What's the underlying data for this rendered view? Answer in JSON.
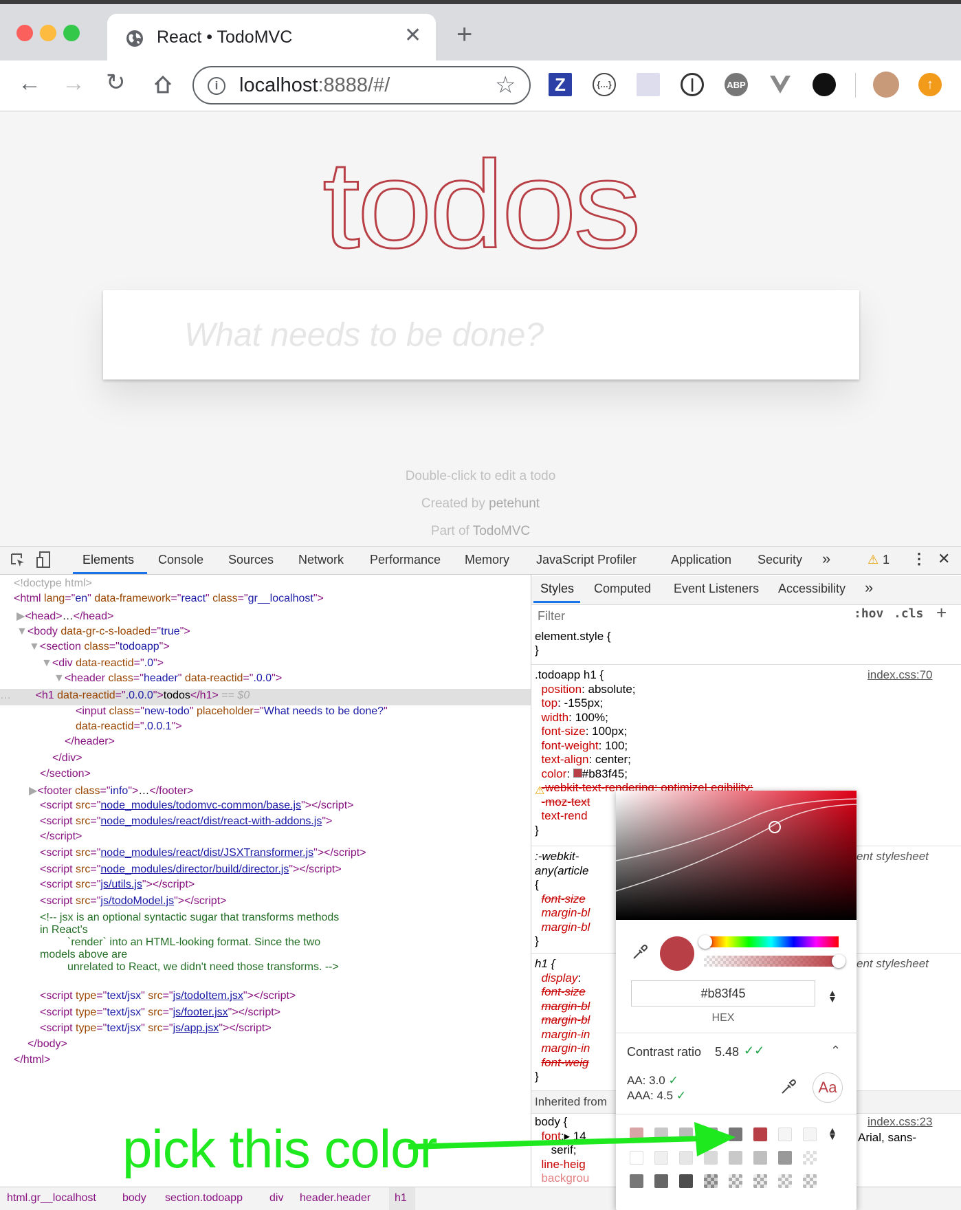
{
  "browser": {
    "tab_title": "React • TodoMVC",
    "url_host": "localhost",
    "url_rest": ":8888/#/",
    "extensions": [
      "Z",
      "{…}",
      "ABP"
    ]
  },
  "page": {
    "heading": "todos",
    "new_todo_placeholder": "What needs to be done?",
    "info_1": "Double-click to edit a todo",
    "info_2_prefix": "Created by ",
    "info_2_link": "petehunt",
    "info_3_prefix": "Part of ",
    "info_3_link": "TodoMVC"
  },
  "devtools": {
    "tabs": [
      "Elements",
      "Console",
      "Sources",
      "Network",
      "Performance",
      "Memory",
      "JavaScript Profiler",
      "Application",
      "Security"
    ],
    "more": "»",
    "warning_count": "1",
    "sidebar_tabs": [
      "Styles",
      "Computed",
      "Event Listeners",
      "Accessibility"
    ],
    "filter_placeholder": "Filter",
    "hov": ":hov",
    "cls": ".cls",
    "inherited_from": "Inherited from ",
    "breadcrumbs": [
      "html.gr__localhost",
      "body",
      "section.todoapp",
      "div",
      "header.header",
      "h1"
    ]
  },
  "picker": {
    "hex": "#b83f45",
    "format": "HEX",
    "contrast_label": "Contrast ratio",
    "contrast_value": "5.48",
    "aa": "AA: 3.0",
    "aaa": "AAA: 4.5",
    "preview": "Aa",
    "current_color": "#b83f45"
  },
  "annotation": {
    "text": "pick this color",
    "color": "#1ee81e"
  },
  "colors": {
    "accent": "#b83f45",
    "tab_active": "#1a73e8"
  }
}
